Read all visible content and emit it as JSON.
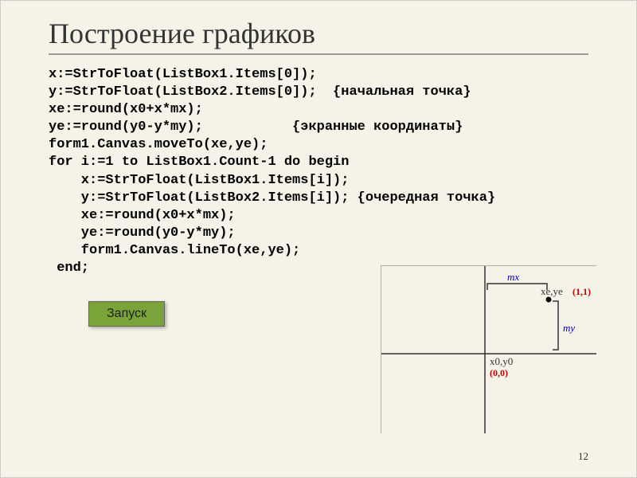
{
  "title": "Построение графиков",
  "code": {
    "l1": "x:=StrToFloat(ListBox1.Items[0]);",
    "l2": "y:=StrToFloat(ListBox2.Items[0]);  {начальная точка}",
    "l3": "xe:=round(x0+x*mx);",
    "l4": "ye:=round(y0-y*my);           {экранные координаты}",
    "l5": "form1.Canvas.moveTo(xe,ye);",
    "l6": "for i:=1 to ListBox1.Count-1 do begin",
    "l7": "    x:=StrToFloat(ListBox1.Items[i]);",
    "l8": "    y:=StrToFloat(ListBox2.Items[i]); {очередная точка}",
    "l9": "    xe:=round(x0+x*mx);",
    "l10": "    ye:=round(y0-y*my);",
    "l11": "    form1.Canvas.lineTo(xe,ye);",
    "l12": " end;"
  },
  "button": {
    "launch": "Запуск"
  },
  "diagram": {
    "mx": "mx",
    "my": "my",
    "xeye": "xe,ye",
    "point11": "(1,1)",
    "x0y0": "x0,y0",
    "origin": "(0,0)"
  },
  "page": "12"
}
